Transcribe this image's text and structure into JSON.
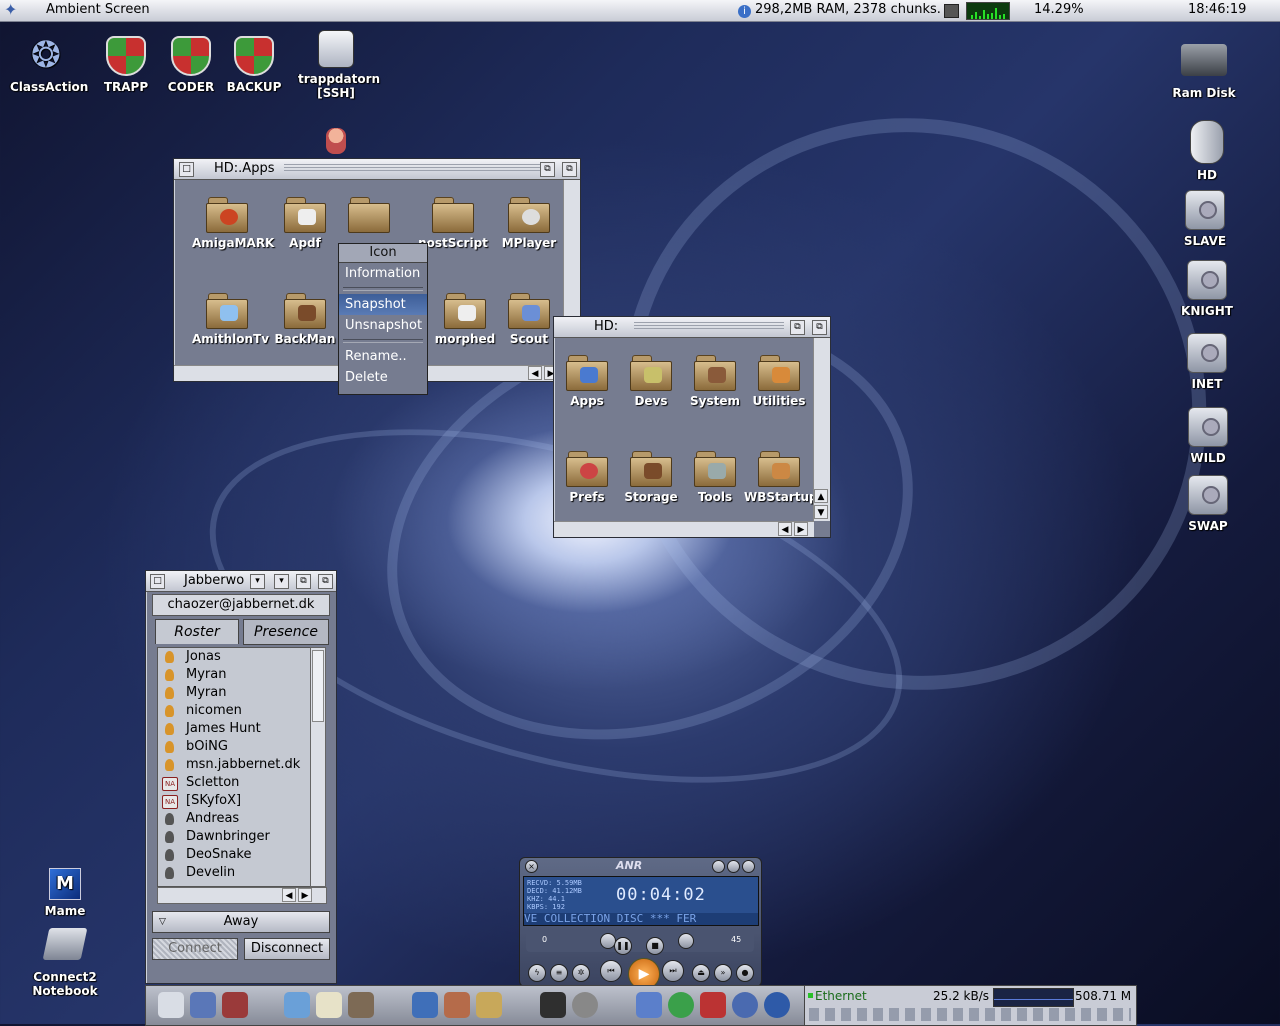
{
  "topbar": {
    "screen_title": "Ambient Screen",
    "ram_info": "298,2MB RAM, 2378 chunks.",
    "cpu_percent": "14.29%",
    "clock": "18:46:19"
  },
  "desktop_icons_left": [
    {
      "label": "ClassAction",
      "icon": "classaction-icon"
    },
    {
      "label": "TRAPP",
      "icon": "shield-icon"
    },
    {
      "label": "CODER",
      "icon": "shield-icon"
    },
    {
      "label": "BACKUP",
      "icon": "shield-icon"
    },
    {
      "label_line1": "trappdatorn",
      "label_line2": "[SSH]",
      "icon": "ssh-icon"
    }
  ],
  "desktop_icons_right": [
    {
      "label": "Ram Disk"
    },
    {
      "label": "HD"
    },
    {
      "label": "SLAVE"
    },
    {
      "label": "KNIGHT"
    },
    {
      "label": "INET"
    },
    {
      "label": "WILD"
    },
    {
      "label": "SWAP"
    }
  ],
  "desktop_icons_bottom": [
    {
      "label": "Mame"
    },
    {
      "label_line1": "Connect2",
      "label_line2": "Notebook"
    }
  ],
  "apps_window": {
    "title": "HD:.Apps",
    "icons": [
      "AmigaMARK",
      "Apdf",
      "",
      "nostScript",
      "MPlayer",
      "AmithlonTv",
      "BackMan",
      "",
      "morphed",
      "Scout"
    ]
  },
  "context_menu": {
    "header": "Icon",
    "items": [
      "Information",
      "Snapshot",
      "Unsnapshot",
      "Rename..",
      "Delete"
    ],
    "selected": "Snapshot"
  },
  "hd_window": {
    "title": "HD:",
    "icons": [
      "Apps",
      "Devs",
      "System",
      "Utilities",
      "Prefs",
      "Storage",
      "Tools",
      "WBStartup"
    ]
  },
  "jabber": {
    "title": "Jabberwo",
    "account": "chaozer@jabbernet.dk",
    "tabs": [
      "Roster",
      "Presence"
    ],
    "roster": [
      {
        "name": "Jonas",
        "status": "online"
      },
      {
        "name": "Myran",
        "status": "online"
      },
      {
        "name": "Myran",
        "status": "online"
      },
      {
        "name": "nicomen",
        "status": "online"
      },
      {
        "name": "James Hunt",
        "status": "online"
      },
      {
        "name": "bOiNG",
        "status": "online"
      },
      {
        "name": "msn.jabbernet.dk",
        "status": "online"
      },
      {
        "name": "Scletton",
        "status": "na"
      },
      {
        "name": "[SKyfoX]",
        "status": "na"
      },
      {
        "name": "Andreas",
        "status": "offline"
      },
      {
        "name": "Dawnbringer",
        "status": "offline"
      },
      {
        "name": "DeoSnake",
        "status": "offline"
      },
      {
        "name": "Develin",
        "status": "offline"
      }
    ],
    "status_select": "Away",
    "connect_label": "Connect",
    "disconnect_label": "Disconnect"
  },
  "player": {
    "logo": "ANR",
    "stats": [
      "RECVD: 5.59MB",
      "DECD: 41.12MB",
      "KHZ: 44.1",
      "KBPS: 192"
    ],
    "time": "00:04:02",
    "ticker": "VE COLLECTION DISC *** FER",
    "left_value": "0",
    "right_value": "45"
  },
  "network": {
    "interface": "Ethernet",
    "rate": "25.2 kB/s",
    "total": "508.71 M"
  },
  "colors": {
    "window_bg": "#767c90",
    "titlebar": "#d8dbe3",
    "menu_selected": "#4a6aa6",
    "folder": "#b79a6a",
    "player_lcd": "#2a4f8e"
  }
}
